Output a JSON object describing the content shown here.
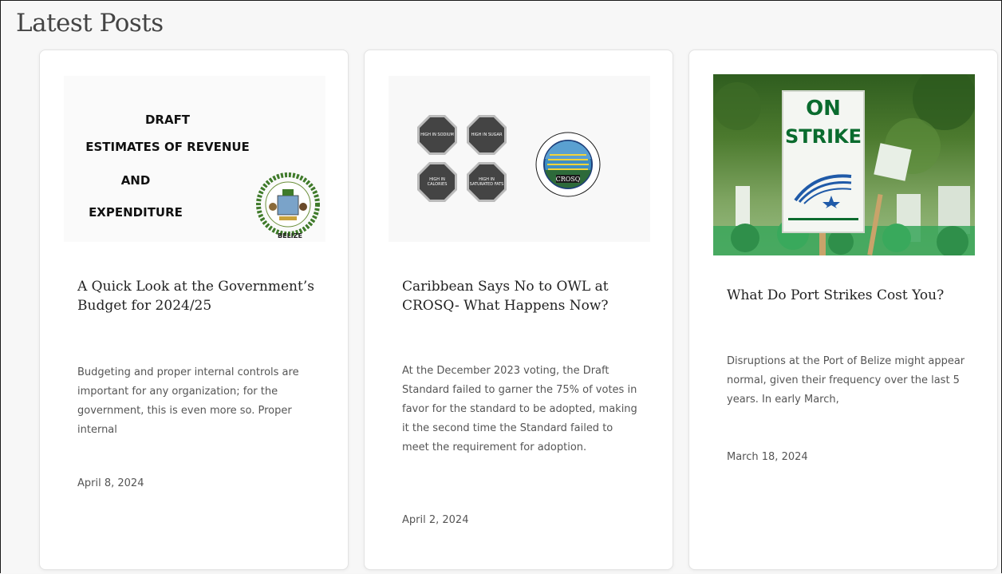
{
  "section": {
    "title": "Latest Posts"
  },
  "posts": [
    {
      "thumb_lines": [
        "DRAFT",
        "ESTIMATES OF REVENUE",
        "AND",
        "EXPENDITURE"
      ],
      "thumb_caption": "BELIZE",
      "title": "A Quick Look at the Government’s Budget for 2024/25",
      "excerpt": "Budgeting and proper internal controls are important for any organization; for the government, this is even more so. Proper internal",
      "date": "April 8, 2024"
    },
    {
      "thumb_labels": [
        "HIGH IN SODIUM",
        "HIGH IN SUGAR",
        "HIGH IN CALORIES",
        "HIGH IN SATURATED FATS"
      ],
      "thumb_logo_text": "CROSQ",
      "title": "Caribbean Says No to OWL at CROSQ- What Happens Now?",
      "excerpt": "At the December 2023 voting, the Draft Standard failed to garner the 75% of votes in favor for the standard to be adopted, making it the second time the Standard failed to meet the requirement for adoption.",
      "date": "April 2, 2024"
    },
    {
      "thumb_sign_lines": [
        "ON",
        "STRIKE"
      ],
      "title": "What Do Port Strikes Cost You?",
      "excerpt": "Disruptions at the Port of Belize might appear normal, given their frequency over the last 5 years. In early March,",
      "date": "March 18, 2024"
    }
  ],
  "colors": {
    "page_bg": "#f7f7f7",
    "card_bg": "#ffffff",
    "strike_green": "#0a6b2e",
    "seal_green": "#3f7a2a"
  }
}
